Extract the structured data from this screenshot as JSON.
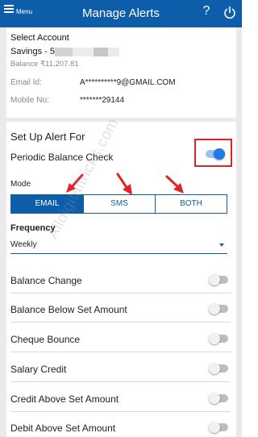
{
  "header": {
    "menu_label": "Menu",
    "title": "Manage Alerts",
    "help_glyph": "?",
    "background": "#0d5dab"
  },
  "account": {
    "heading": "Select Account",
    "account_name": "Savings - 5",
    "balance": "Balance ₹11,207.81",
    "email_label": "Email Id:",
    "email_value": "A**********9@GMAIL.COM",
    "mobile_label": "Mobile No:",
    "mobile_value": "*******29144"
  },
  "alert_setup": {
    "heading": "Set Up Alert For",
    "periodic_balance_check": {
      "label": "Periodic Balance Check",
      "enabled": true
    },
    "mode_label": "Mode",
    "modes": [
      {
        "label": "EMAIL",
        "selected": true
      },
      {
        "label": "SMS",
        "selected": false
      },
      {
        "label": "BOTH",
        "selected": false
      }
    ],
    "frequency_label": "Frequency",
    "frequency_value": "Weekly"
  },
  "alert_options": [
    {
      "label": "Balance Change",
      "enabled": false
    },
    {
      "label": "Balance Below Set Amount",
      "enabled": false
    },
    {
      "label": "Cheque Bounce",
      "enabled": false
    },
    {
      "label": "Salary Credit",
      "enabled": false
    },
    {
      "label": "Credit Above Set Amount",
      "enabled": false
    },
    {
      "label": "Debit Above Set Amount",
      "enabled": false
    }
  ],
  "watermark": "Alldigitaltricks.com",
  "colors": {
    "accent": "#0d5dab",
    "toggle_on": "#1e7be6",
    "annotation": "#e02424"
  },
  "icons": [
    "menu-icon",
    "help-icon",
    "power-icon",
    "dropdown-caret-icon"
  ]
}
